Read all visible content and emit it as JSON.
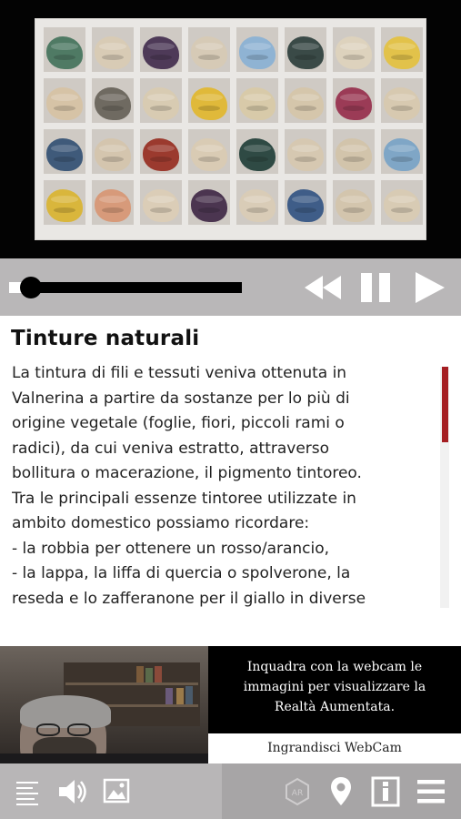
{
  "hero": {
    "image_description_icon": "yarn-shelf-image",
    "rows": [
      [
        "#4f7a64",
        "#d8cbb5",
        "#4e3a58",
        "#d6cab6",
        "#8fb3d3",
        "#3a4a47",
        "#ddd2bd",
        "#e2c24a"
      ],
      [
        "#d6c3a6",
        "#6f6a61",
        "#d8cbb2",
        "#e0b93a",
        "#d8caa9",
        "#d5c6ab",
        "#9b3b56",
        "#d7c9b0"
      ],
      [
        "#3f5a7a",
        "#d4c5ae",
        "#9b3a2e",
        "#d9cbb4",
        "#2f4a44",
        "#d6c8b1",
        "#d2c4ab",
        "#7fa6c6"
      ],
      [
        "#d9b63c",
        "#d79a7a",
        "#dbcdb7",
        "#4b3550",
        "#d9ccb7",
        "#3f5d88",
        "#d3c5ad",
        "#d8cbb4"
      ]
    ]
  },
  "player": {
    "progress": 0.06,
    "rewind_icon": "rewind-icon",
    "pause_icon": "pause-icon",
    "play_icon": "play-icon"
  },
  "content": {
    "title": "Tinture naturali",
    "body": "La tintura di fili e tessuti veniva ottenuta in\nValnerina a partire da sostanze per lo più di\norigine vegetale (foglie, fiori, piccoli rami o\nradici), da cui veniva estratto, attraverso\nbollitura o macerazione, il pigmento tintoreo.\nTra le principali essenze tintoree utilizzate in\nambito domestico possiamo ricordare:\n- la robbia per ottenere un rosso/arancio,\n- la lappa, la liffa di quercia o spolverone, la\nreseda e lo zafferanone per il giallo in diverse",
    "scroll_fraction": 0.31,
    "accent": "#a51e22"
  },
  "webcam": {
    "info": "Inquadra con la webcam le\nimmagini per visualizzare la\nRealtà Aumentata.",
    "enlarge_label": "Ingrandisci WebCam"
  },
  "toolbar": {
    "left_icons": [
      "text-icon",
      "speaker-icon",
      "image-icon"
    ],
    "right_icons": [
      "ar-cube-icon",
      "map-pin-icon",
      "info-icon",
      "menu-icon"
    ]
  }
}
